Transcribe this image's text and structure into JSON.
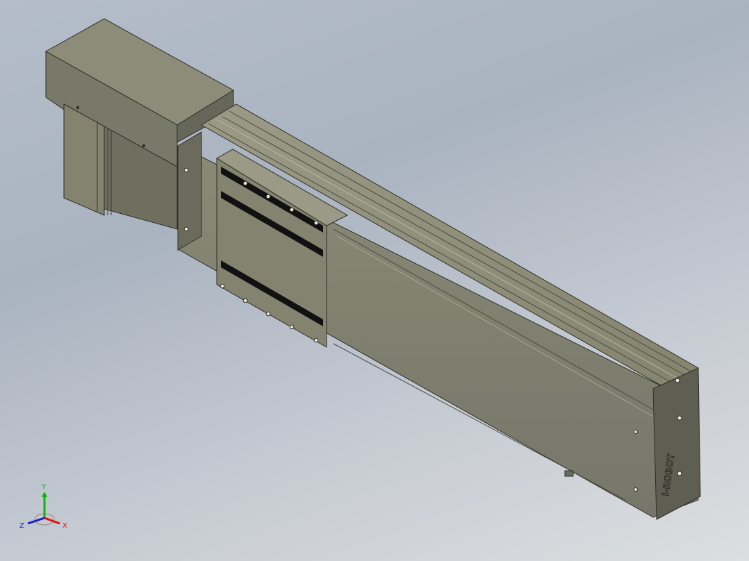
{
  "viewport": {
    "background_top": "#aab3c0",
    "background_bottom": "#dcdedf",
    "model_body_color": "#7b7b69",
    "model_shadow_color": "#5a5a4a",
    "model_highlight_color": "#a6a693",
    "end_cap_color": "#66665a"
  },
  "end_cap": {
    "logo_text": "I-ROBOT"
  },
  "triad": {
    "x_label": "X",
    "y_label": "Y",
    "z_label": "Z",
    "x_color": "#e01010",
    "y_color": "#10b010",
    "z_color": "#1020d0"
  }
}
